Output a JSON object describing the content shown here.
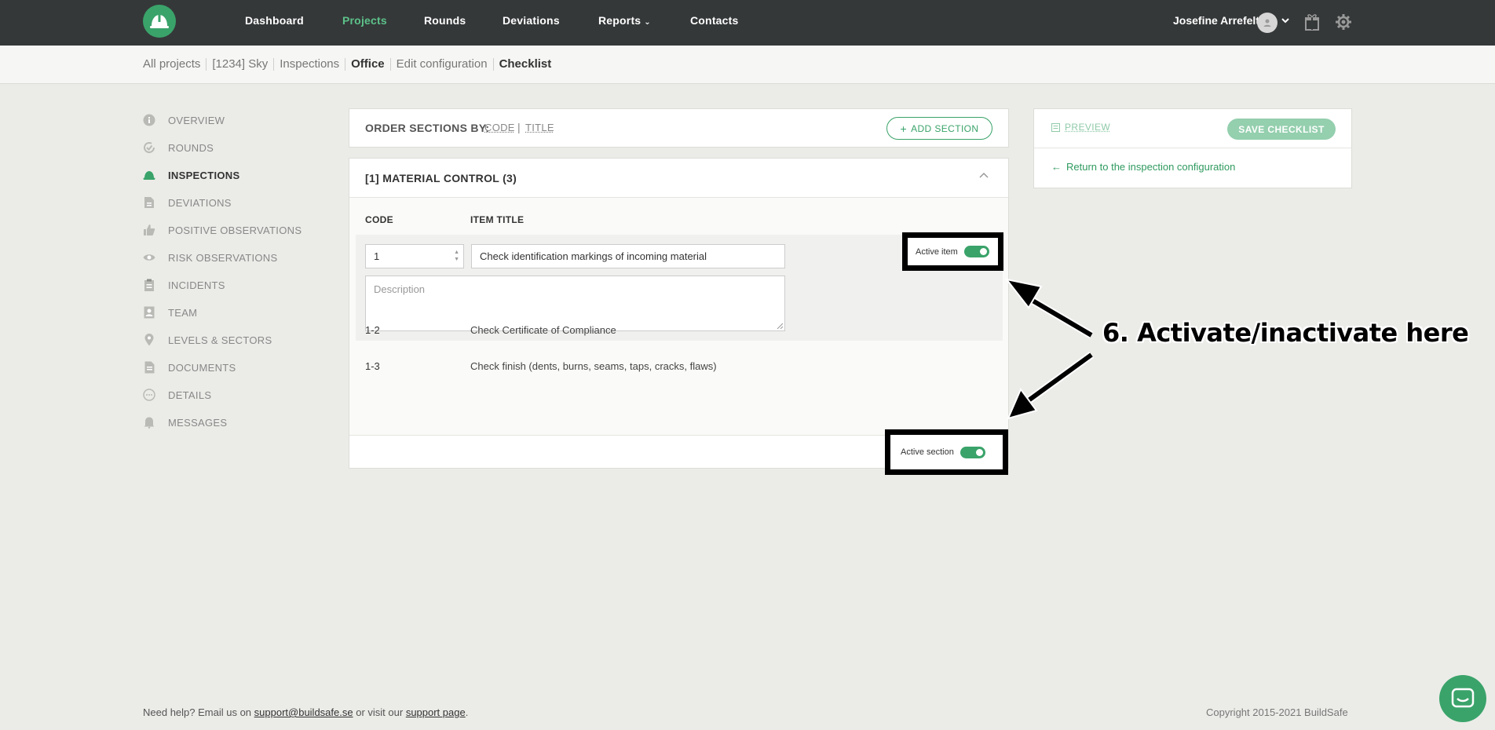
{
  "topnav": {
    "items": [
      {
        "label": "Dashboard"
      },
      {
        "label": "Projects"
      },
      {
        "label": "Rounds"
      },
      {
        "label": "Deviations"
      },
      {
        "label": "Reports"
      },
      {
        "label": "Contacts"
      }
    ],
    "user_name": "Josefine Arrefelt",
    "icons": [
      "helmet-logo-icon",
      "user-avatar-icon",
      "chevron-down-icon",
      "gift-icon",
      "settings-icon"
    ]
  },
  "breadcrumb": [
    "All projects",
    "[1234] Sky",
    "Inspections",
    "Office",
    "Edit configuration",
    "Checklist"
  ],
  "sidebar": {
    "items": [
      {
        "label": "OVERVIEW",
        "icon": "info-icon"
      },
      {
        "label": "ROUNDS",
        "icon": "rounds-icon"
      },
      {
        "label": "INSPECTIONS",
        "icon": "helmet-icon"
      },
      {
        "label": "DEVIATIONS",
        "icon": "document-icon"
      },
      {
        "label": "POSITIVE OBSERVATIONS",
        "icon": "thumbs-up-icon"
      },
      {
        "label": "RISK OBSERVATIONS",
        "icon": "eye-icon"
      },
      {
        "label": "INCIDENTS",
        "icon": "clipboard-icon"
      },
      {
        "label": "TEAM",
        "icon": "team-icon"
      },
      {
        "label": "LEVELS & SECTORS",
        "icon": "location-pin-icon"
      },
      {
        "label": "DOCUMENTS",
        "icon": "file-icon"
      },
      {
        "label": "DETAILS",
        "icon": "dots-icon"
      },
      {
        "label": "MESSAGES",
        "icon": "bell-icon"
      }
    ]
  },
  "order": {
    "label": "ORDER SECTIONS BY:",
    "code": "CODE",
    "separator": "|",
    "title": "TITLE",
    "add_section": "ADD SECTION"
  },
  "section": {
    "title": "[1] MATERIAL CONTROL (3)",
    "col_code": "CODE",
    "col_title": "ITEM TITLE",
    "editing_item": {
      "code": "1",
      "title": "Check identification markings of incoming material",
      "description_placeholder": "Description",
      "active_label": "Active item",
      "active": true
    },
    "items": [
      {
        "code": "1-2",
        "title": "Check Certificate of Compliance"
      },
      {
        "code": "1-3",
        "title": "Check finish (dents, burns, seams, taps, cracks, flaws)"
      }
    ],
    "active_section_label": "Active section",
    "active_section": true
  },
  "right_panel": {
    "preview": "PREVIEW",
    "save": "SAVE CHECKLIST",
    "return_link": "Return to the inspection configuration"
  },
  "annotation": {
    "text": "6. Activate/inactivate here"
  },
  "footer": {
    "help_prefix": "Need help? Email us on",
    "email": "support@buildsafe.se",
    "help_middle": "or visit our",
    "support_link": "support page",
    "help_suffix": ".",
    "copyright": "Copyright 2015-2021 BuildSafe"
  },
  "colors": {
    "brand_green": "#3aa36a",
    "topbar": "#353839",
    "background": "#ebece8"
  }
}
